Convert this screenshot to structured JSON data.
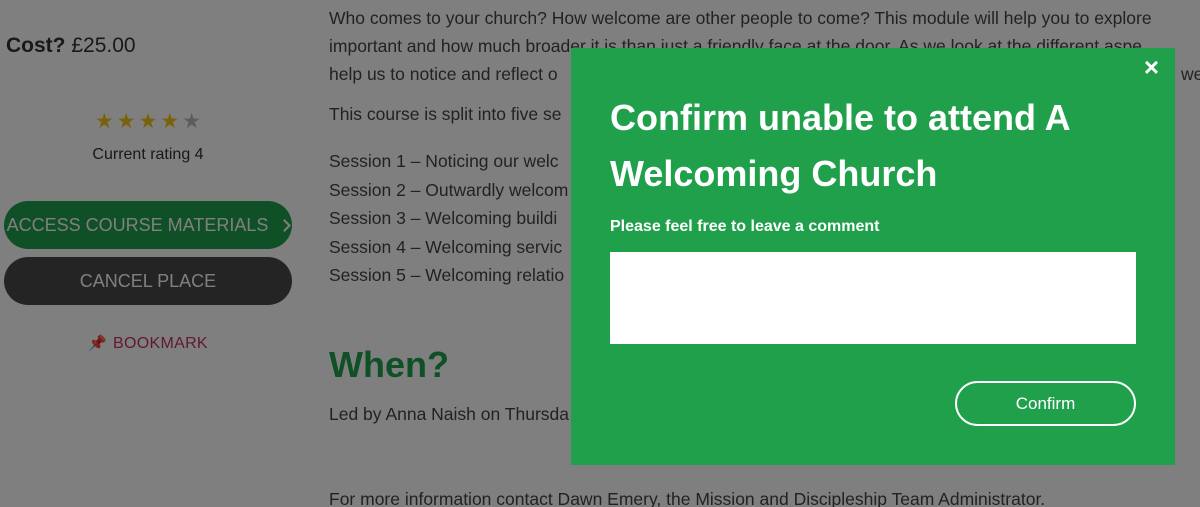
{
  "sidebar": {
    "cost_label": "Cost?",
    "cost_value": "£25.00",
    "rating_value": 4,
    "rating_max": 5,
    "rating_text": "Current rating 4",
    "access_button_label": "ACCESS COURSE MATERIALS",
    "cancel_button_label": "CANCEL PLACE",
    "bookmark_label": "BOOKMARK"
  },
  "main": {
    "intro_lines": [
      "Who comes to your church? How welcome are other people to come? This module will help you to explore",
      "important and how much broader it is than just a friendly face at the door. As we look at the different aspe",
      "help us to notice and reflect o"
    ],
    "intro_line3_tail": "we",
    "split_text": "This course is split into five se",
    "sessions": [
      "Session 1 – Noticing our welc",
      "Session 2 – Outwardly welcom",
      "Session 3 – Welcoming buildi",
      "Session 4 – Welcoming servic",
      "Session 5 – Welcoming relatio"
    ],
    "when_heading": "When?",
    "led_text": "Led by Anna Naish on Thursda",
    "more_info_text": "For more information contact Dawn Emery, the Mission and Discipleship Team Administrator."
  },
  "modal": {
    "close_label": "×",
    "title": "Confirm unable to attend A Welcoming Church",
    "comment_label": "Please feel free to leave a comment",
    "comment_value": "",
    "confirm_label": "Confirm"
  },
  "colors": {
    "accent_green": "#21a04c",
    "bookmark_pink": "#c03366",
    "cancel_grey": "#484848",
    "star_filled": "#f5c518",
    "star_empty": "#b9b9b9"
  }
}
